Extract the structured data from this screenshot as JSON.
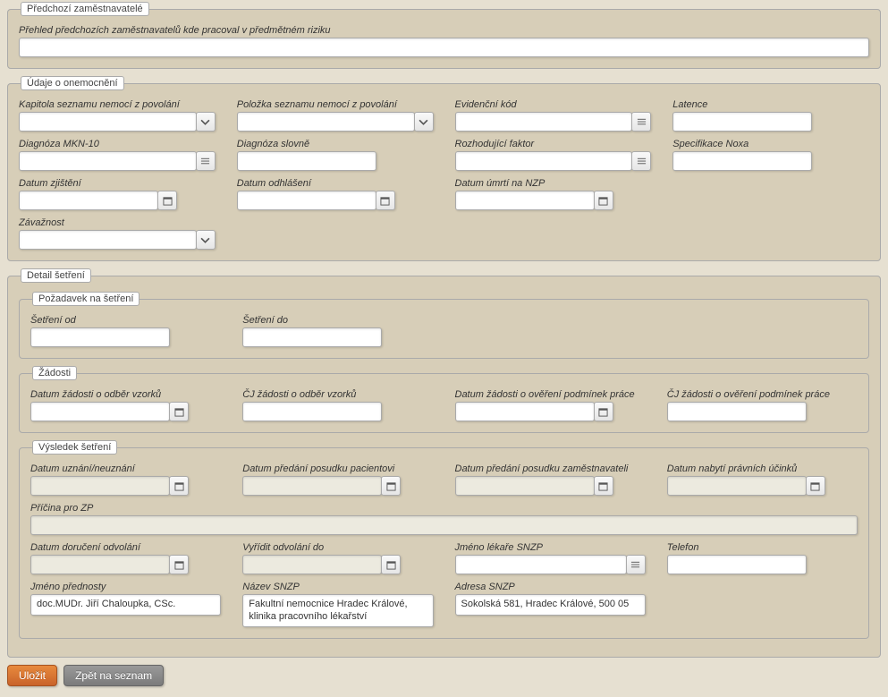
{
  "fieldset_prev": {
    "legend": "Předchozí zaměstnavatelé",
    "overview_label": "Přehled předchozích zaměstnavatelů kde pracoval v předmětném riziku"
  },
  "fieldset_disease": {
    "legend": "Údaje o onemocnění",
    "kapitola": "Kapitola seznamu nemocí z povolání",
    "polozka": "Položka seznamu nemocí z povolání",
    "evidencni": "Evidenční kód",
    "latence": "Latence",
    "diag_mkn10": "Diagnóza MKN-10",
    "diag_slovne": "Diagnóza slovně",
    "rozhodujici": "Rozhodující faktor",
    "specifikace": "Specifikace Noxa",
    "datum_zjisteni": "Datum zjištění",
    "datum_odhlaseni": "Datum odhlášení",
    "datum_umrti": "Datum úmrtí na NZP",
    "zavaznost": "Závažnost"
  },
  "fieldset_detail": {
    "legend": "Detail šetření",
    "pozadavek_legend": "Požadavek na šetření",
    "setreni_od": "Šetření od",
    "setreni_do": "Šetření do",
    "zadosti_legend": "Žádosti",
    "datum_zadosti_vzorku": "Datum žádosti o odběr vzorků",
    "cj_zadosti_vzorku": "ČJ žádosti o odběr vzorků",
    "datum_zadosti_overeni": "Datum žádosti o ověření podmínek práce",
    "cj_zadosti_overeni": "ČJ žádosti o ověření podmínek práce"
  },
  "fieldset_vysledek": {
    "legend": "Výsledek šetření",
    "datum_uznani": "Datum uznání/neuznání",
    "datum_predani_pac": "Datum předání posudku pacientovi",
    "datum_predani_zam": "Datum předání posudku zaměstnavateli",
    "datum_nabyti": "Datum nabytí právních účinků",
    "pricina_zp": "Příčina pro ZP",
    "datum_doruceni": "Datum doručení odvolání",
    "vyridit_do": "Vyřídit odvolání do",
    "jmeno_lekare": "Jméno lékaře SNZP",
    "telefon": "Telefon",
    "jmeno_prednosty": "Jméno přednosty",
    "jmeno_prednosty_val": "doc.MUDr. Jiří Chaloupka, CSc.",
    "nazev_snzp": "Název SNZP",
    "nazev_snzp_val": "Fakultní nemocnice Hradec Králové, klinika pracovního lékařství",
    "adresa_snzp": "Adresa SNZP",
    "adresa_snzp_val": "Sokolská 581, Hradec Králové, 500 05"
  },
  "buttons": {
    "save": "Uložit",
    "back": "Zpět na seznam"
  }
}
